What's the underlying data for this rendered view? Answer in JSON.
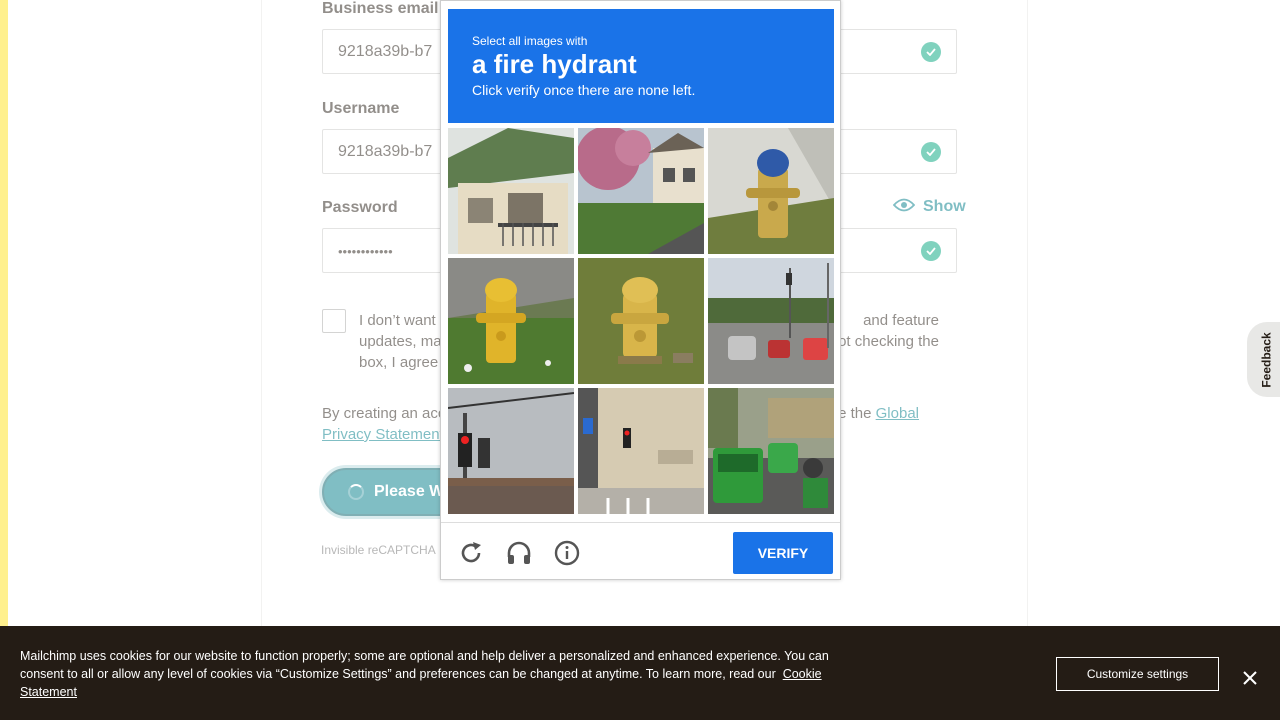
{
  "form": {
    "email": {
      "label": "Business email",
      "value": "9218a39b-b7"
    },
    "username": {
      "label": "Username",
      "value": "9218a39b-b7"
    },
    "password": {
      "label": "Password",
      "value": "••••••••••••",
      "show_label": "Show"
    },
    "optout_text": "I don’t want t… and feature updates, ma… ot checking the box, I agree t…",
    "optout_line1a": "I don’t want t",
    "optout_line1b": "and feature",
    "optout_line2a": "updates, ma",
    "optout_line2b": "ot checking the",
    "optout_line3a": "box, I agree t",
    "legal_prefix": "By creating an acc",
    "legal_mid": "e the",
    "legal_link1": "Global",
    "legal_link2": "Privacy Statement",
    "submit_label": "Please Wa",
    "recaptcha_note": "Invisible reCAPTCHA"
  },
  "captcha": {
    "instruction_small": "Select all images with",
    "target": "a fire hydrant",
    "instruction_sub": "Click verify once there are none left.",
    "tiles": [
      "house-balcony",
      "house-tree",
      "blue-top-hydrant",
      "yellow-hydrant-grass",
      "yellow-hydrant-lawn",
      "street-intersection",
      "traffic-light",
      "building-traffic-light",
      "green-truck-traffic"
    ],
    "verify_label": "VERIFY",
    "footer_icons": [
      "reload-icon",
      "headphones-icon",
      "info-icon"
    ]
  },
  "feedback_label": "Feedback",
  "cookie": {
    "text": "Mailchimp uses cookies for our website to function properly; some are optional and help deliver a personalized and enhanced experience. You can consent to all or allow any level of cookies via “Customize Settings” and preferences can be changed at anytime. To learn more, read our",
    "link": "Cookie Statement",
    "customize_label": "Customize settings"
  },
  "colors": {
    "brand_yellow": "#ffe01b",
    "teal": "#007c89",
    "captcha_blue": "#1a73e8",
    "banner_dark": "#241c15",
    "check_green": "#00a47c"
  }
}
